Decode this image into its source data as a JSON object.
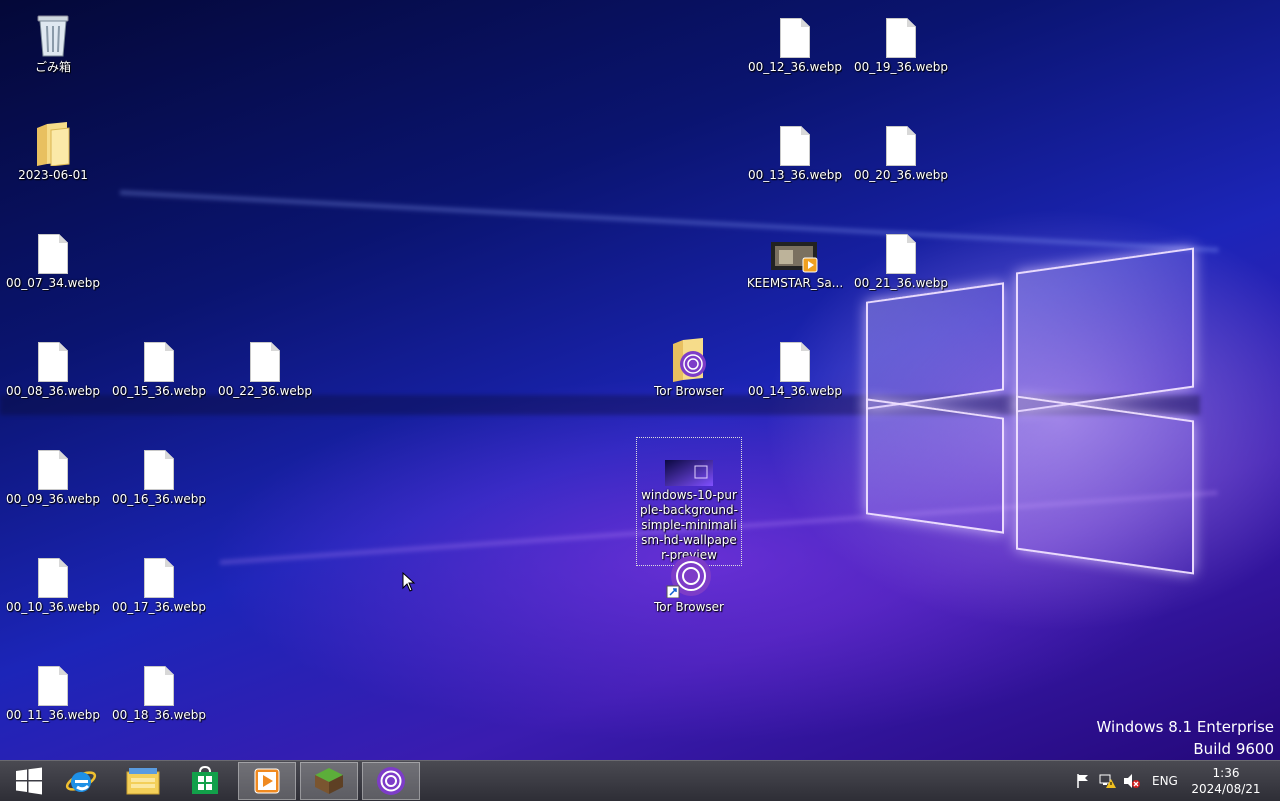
{
  "desktop": {
    "icons": {
      "recycle_bin": "ごみ箱",
      "folder_2023": "2023-06-01",
      "f_00_07_34": "00_07_34.webp",
      "f_00_08_36": "00_08_36.webp",
      "f_00_09_36": "00_09_36.webp",
      "f_00_10_36": "00_10_36.webp",
      "f_00_11_36": "00_11_36.webp",
      "f_00_15_36": "00_15_36.webp",
      "f_00_16_36": "00_16_36.webp",
      "f_00_17_36": "00_17_36.webp",
      "f_00_18_36": "00_18_36.webp",
      "f_00_22_36": "00_22_36.webp",
      "f_00_12_36": "00_12_36.webp",
      "f_00_13_36": "00_13_36.webp",
      "f_00_14_36": "00_14_36.webp",
      "f_00_19_36": "00_19_36.webp",
      "f_00_20_36": "00_20_36.webp",
      "f_00_21_36": "00_21_36.webp",
      "keemstar": "KEEMSTAR_Sa...",
      "tor_folder": "Tor Browser",
      "tor_shortcut": "Tor Browser",
      "wallpaper": "windows-10-purple-background-simple-minimalism-hd-wallpaper-preview"
    }
  },
  "watermark": {
    "line1": "Windows 8.1 Enterprise",
    "line2": "Build 9600"
  },
  "taskbar": {
    "start_icon": "windows-start-icon",
    "pinned": [
      "internet-explorer-icon",
      "file-explorer-icon",
      "store-icon",
      "media-player-icon",
      "minecraft-icon",
      "tor-browser-icon"
    ],
    "tray": {
      "language": "ENG",
      "time": "1:36",
      "date": "2024/08/21"
    }
  },
  "colors": {
    "taskbar": "#3a3a42",
    "tor_purple": "#7d3cc8",
    "ie_blue": "#1e90e6",
    "store_green": "#12a04a"
  }
}
